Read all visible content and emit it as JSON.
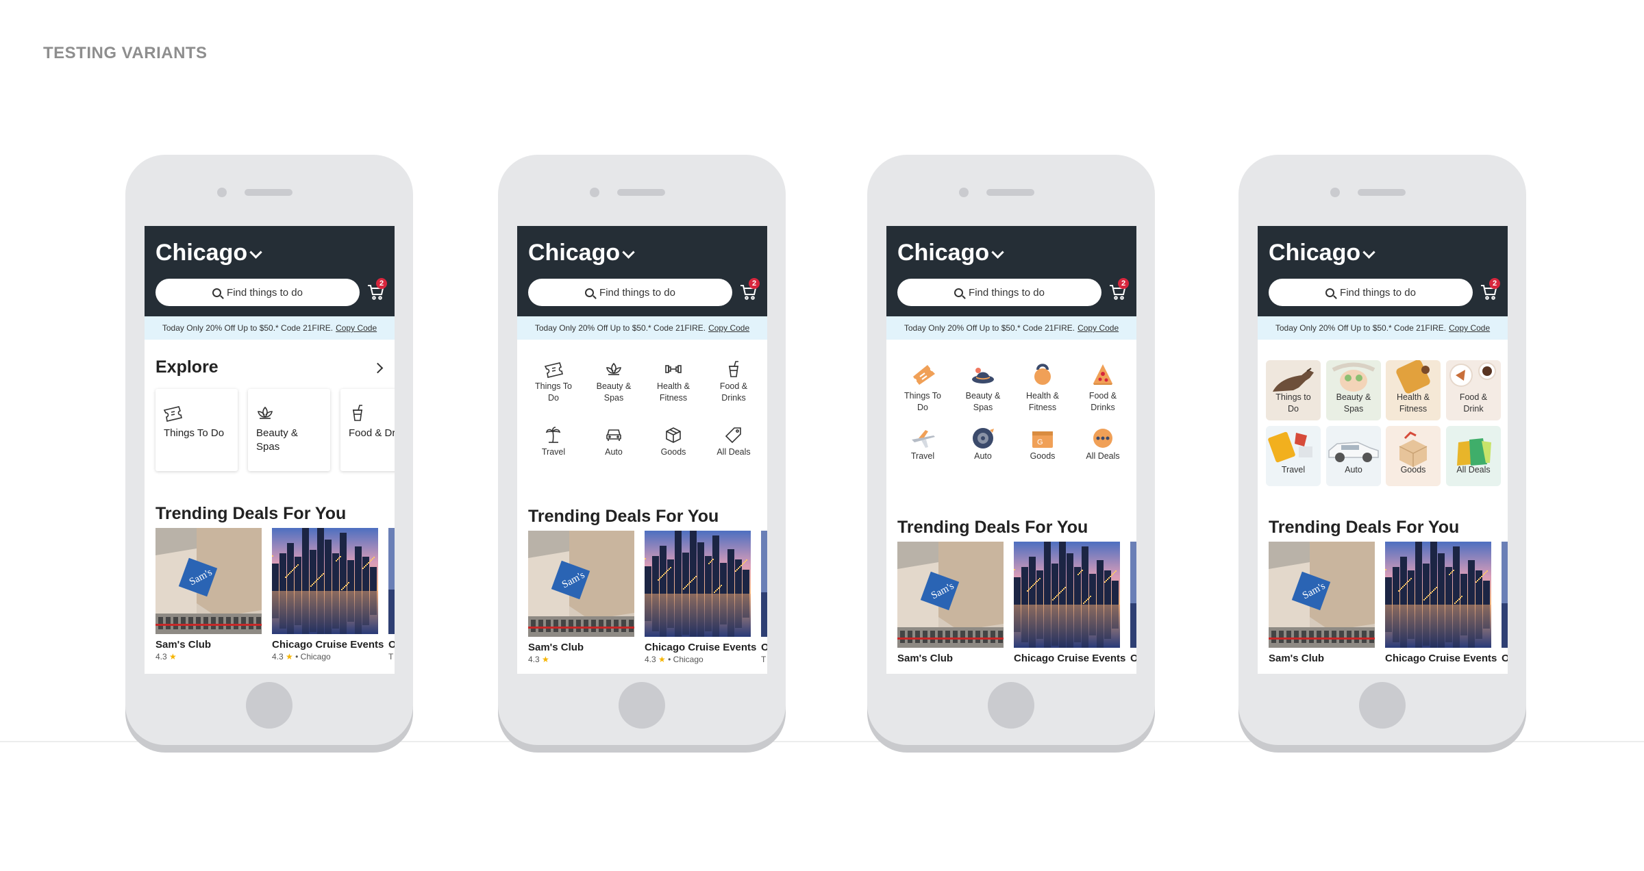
{
  "page": {
    "title": "TESTING VARIANTS"
  },
  "app": {
    "city": "Chicago",
    "search_placeholder": "Find things to do",
    "cart_count": "2",
    "promo_text": "Today Only 20% Off Up to $50.*  Code 21FIRE.",
    "promo_link": "Copy Code",
    "explore_title": "Explore",
    "trending_title": "Trending Deals For You"
  },
  "explore_cards": [
    {
      "label": "Things To Do",
      "icon": "ticket-icon"
    },
    {
      "label": "Beauty &\nSpas",
      "icon": "lotus-icon"
    },
    {
      "label": "Food & Dr",
      "icon": "drink-icon"
    }
  ],
  "categories_line": [
    {
      "label": "Things To\nDo",
      "icon": "ticket-icon"
    },
    {
      "label": "Beauty &\nSpas",
      "icon": "lotus-icon"
    },
    {
      "label": "Health &\nFitness",
      "icon": "dumbbell-icon"
    },
    {
      "label": "Food &\nDrinks",
      "icon": "drink-icon"
    },
    {
      "label": "Travel",
      "icon": "palm-tree-icon"
    },
    {
      "label": "Auto",
      "icon": "car-icon"
    },
    {
      "label": "Goods",
      "icon": "box-icon"
    },
    {
      "label": "All Deals",
      "icon": "tag-icon"
    }
  ],
  "categories_color": [
    {
      "label": "Things To\nDo",
      "icon": "ticket-icon"
    },
    {
      "label": "Beauty &\nSpas",
      "icon": "hat-icon"
    },
    {
      "label": "Health &\nFitness",
      "icon": "kettlebell-icon"
    },
    {
      "label": "Food &\nDrinks",
      "icon": "pizza-icon"
    },
    {
      "label": "Travel",
      "icon": "airplane-icon"
    },
    {
      "label": "Auto",
      "icon": "tire-icon"
    },
    {
      "label": "Goods",
      "icon": "box-icon"
    },
    {
      "label": "All Deals",
      "icon": "more-icon"
    }
  ],
  "categories_photo": [
    {
      "label": "Things to\nDo",
      "icon": "dinosaur-photo"
    },
    {
      "label": "Beauty &\nSpas",
      "icon": "facial-photo"
    },
    {
      "label": "Health &\nFitness",
      "icon": "yoga-photo"
    },
    {
      "label": "Food &\nDrink",
      "icon": "coffee-photo"
    },
    {
      "label": "Travel",
      "icon": "luggage-photo"
    },
    {
      "label": "Auto",
      "icon": "car-photo"
    },
    {
      "label": "Goods",
      "icon": "package-photo"
    },
    {
      "label": "All Deals",
      "icon": "shopping-bags-photo"
    }
  ],
  "deals": [
    {
      "name": "Sam's Club",
      "rating": "4.3",
      "location": ""
    },
    {
      "name": "Chicago Cruise Events",
      "rating": "4.3",
      "location": "• Chicago"
    },
    {
      "name": "O",
      "rating": "",
      "location": "T"
    }
  ],
  "colors": {
    "header": "#252e36",
    "promo_bg": "#e2f3fb",
    "badge": "#d7263d",
    "icon_orange": "#f0a057",
    "icon_navy": "#3b4a6b",
    "star": "#f5b400"
  }
}
